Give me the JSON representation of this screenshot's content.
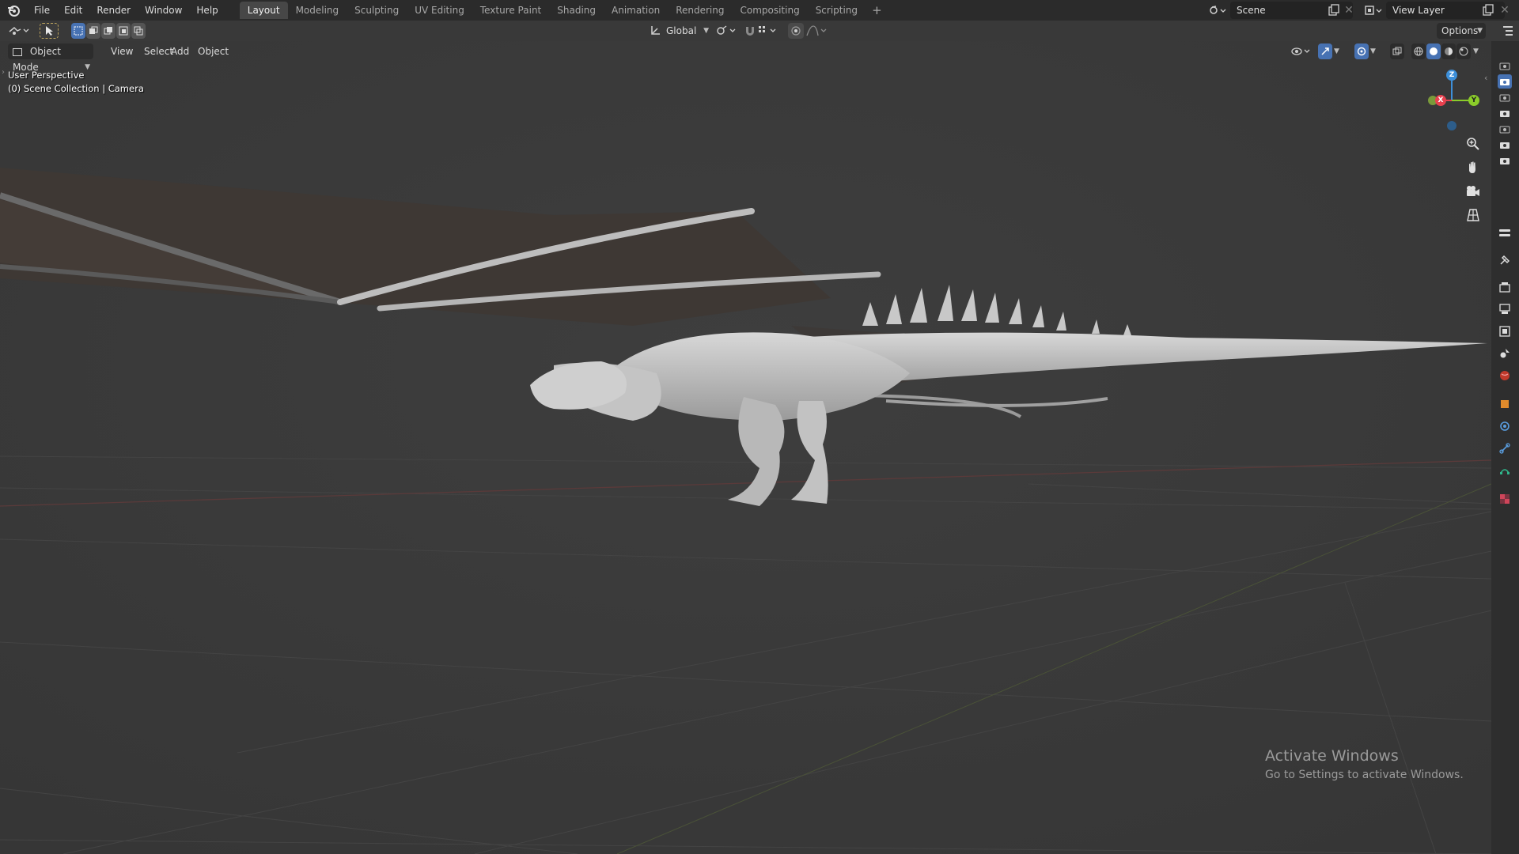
{
  "menu": {
    "items": [
      "File",
      "Edit",
      "Render",
      "Window",
      "Help"
    ]
  },
  "workspaces": {
    "tabs": [
      "Layout",
      "Modeling",
      "Sculpting",
      "UV Editing",
      "Texture Paint",
      "Shading",
      "Animation",
      "Rendering",
      "Compositing",
      "Scripting"
    ],
    "active": "Layout"
  },
  "scene": {
    "label": "Scene"
  },
  "view_layer": {
    "label": "View Layer"
  },
  "toolbar": {
    "transform_orientation": "Global",
    "options_label": "Options"
  },
  "header": {
    "mode_label": "Object Mode",
    "menus": [
      "View",
      "Select",
      "Add",
      "Object"
    ]
  },
  "viewport": {
    "view_name": "User Perspective",
    "collection_info": "(0) Scene Collection | Camera"
  },
  "gizmo": {
    "x": "X",
    "y": "Y",
    "z": "Z"
  },
  "watermark": {
    "title": "Activate Windows",
    "subtitle": "Go to Settings to activate Windows."
  },
  "colors": {
    "accent_blue": "#4772b3",
    "axis_x": "#e8414f",
    "axis_y": "#8bcc2a",
    "axis_z": "#3d8fd9"
  }
}
